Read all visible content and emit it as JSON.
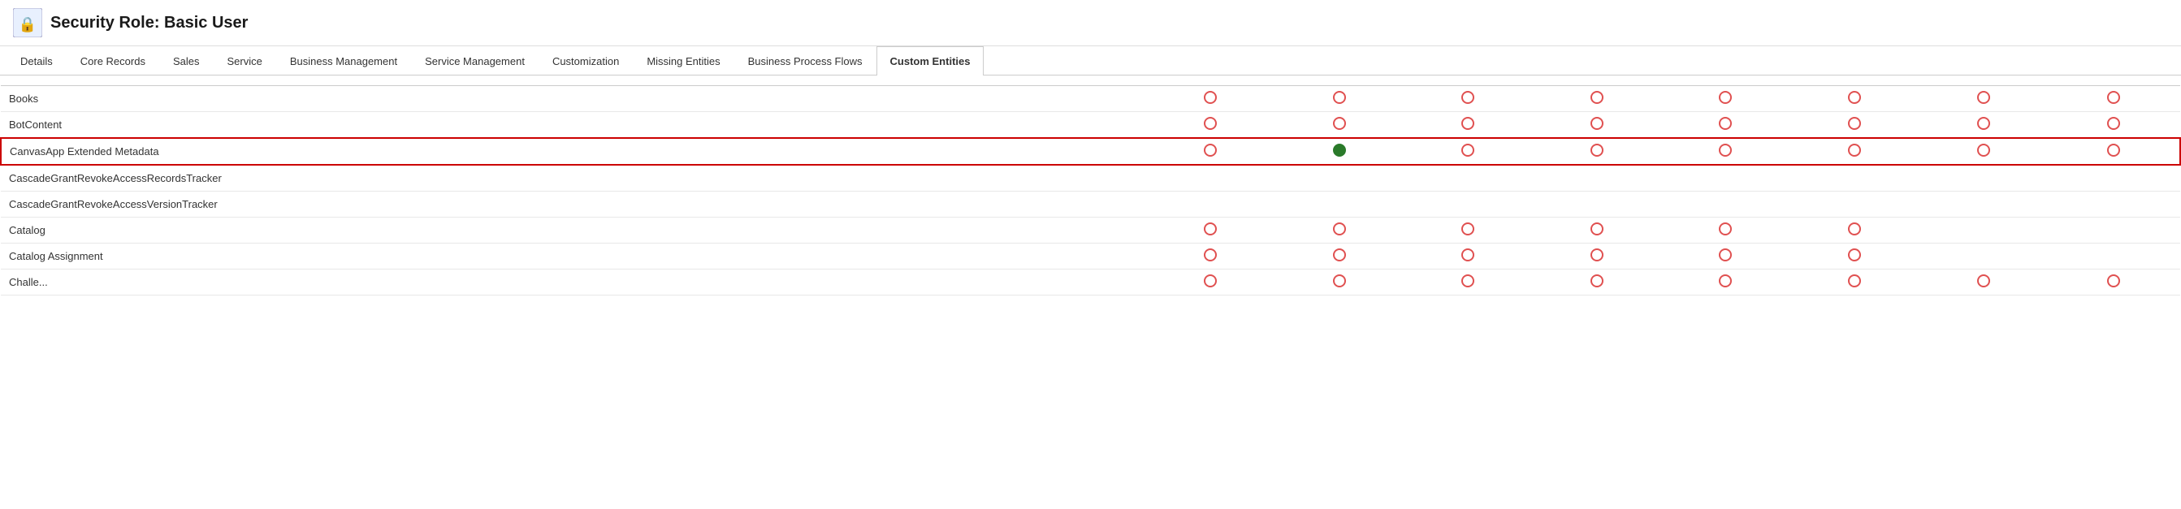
{
  "header": {
    "title": "Security Role: Basic User",
    "icon_label": "security-role-icon"
  },
  "tabs": [
    {
      "id": "details",
      "label": "Details",
      "active": false
    },
    {
      "id": "core-records",
      "label": "Core Records",
      "active": false
    },
    {
      "id": "sales",
      "label": "Sales",
      "active": false
    },
    {
      "id": "service",
      "label": "Service",
      "active": false
    },
    {
      "id": "business-management",
      "label": "Business Management",
      "active": false
    },
    {
      "id": "service-management",
      "label": "Service Management",
      "active": false
    },
    {
      "id": "customization",
      "label": "Customization",
      "active": false
    },
    {
      "id": "missing-entities",
      "label": "Missing Entities",
      "active": false
    },
    {
      "id": "business-process-flows",
      "label": "Business Process Flows",
      "active": false
    },
    {
      "id": "custom-entities",
      "label": "Custom Entities",
      "active": true
    }
  ],
  "table": {
    "columns": [
      {
        "id": "entity-name",
        "label": "",
        "align": "left"
      },
      {
        "id": "col1",
        "label": ""
      },
      {
        "id": "col2",
        "label": ""
      },
      {
        "id": "col3",
        "label": ""
      },
      {
        "id": "col4",
        "label": ""
      },
      {
        "id": "col5",
        "label": ""
      },
      {
        "id": "col6",
        "label": ""
      },
      {
        "id": "col7",
        "label": ""
      },
      {
        "id": "col8",
        "label": ""
      }
    ],
    "rows": [
      {
        "name": "Books",
        "highlighted": false,
        "cells": [
          "empty",
          "empty",
          "empty",
          "empty",
          "empty",
          "empty",
          "empty",
          "empty"
        ]
      },
      {
        "name": "BotContent",
        "highlighted": false,
        "cells": [
          "empty",
          "empty",
          "empty",
          "empty",
          "empty",
          "empty",
          "empty",
          "empty"
        ]
      },
      {
        "name": "CanvasApp Extended Metadata",
        "highlighted": true,
        "cells": [
          "empty",
          "filled",
          "empty",
          "empty",
          "empty",
          "empty",
          "empty",
          "empty"
        ]
      },
      {
        "name": "CascadeGrantRevokeAccessRecordsTracker",
        "highlighted": false,
        "cells": [
          "none",
          "none",
          "none",
          "none",
          "none",
          "none",
          "none",
          "none"
        ]
      },
      {
        "name": "CascadeGrantRevokeAccessVersionTracker",
        "highlighted": false,
        "cells": [
          "none",
          "none",
          "none",
          "none",
          "none",
          "none",
          "none",
          "none"
        ]
      },
      {
        "name": "Catalog",
        "highlighted": false,
        "cells": [
          "empty",
          "empty",
          "empty",
          "empty",
          "empty",
          "empty",
          "none",
          "none"
        ]
      },
      {
        "name": "Catalog Assignment",
        "highlighted": false,
        "cells": [
          "empty",
          "empty",
          "empty",
          "empty",
          "empty",
          "empty",
          "none",
          "none"
        ]
      },
      {
        "name": "Challe...",
        "highlighted": false,
        "cells": [
          "empty",
          "empty",
          "empty",
          "empty",
          "empty",
          "empty",
          "empty",
          "empty"
        ]
      }
    ]
  }
}
